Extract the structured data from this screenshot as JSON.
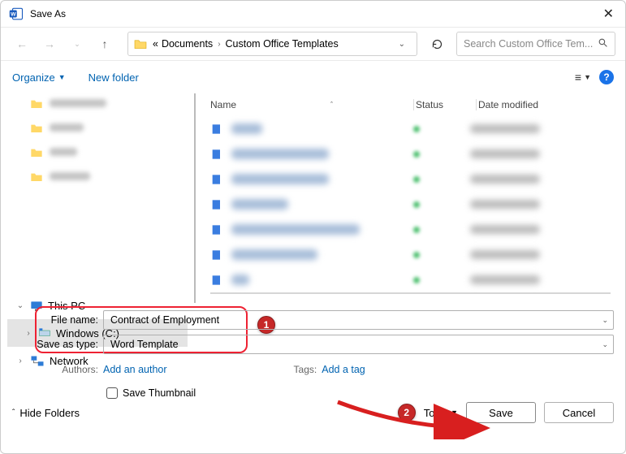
{
  "title": "Save As",
  "breadcrumb": {
    "prefix_indicator": "«",
    "segment1": "Documents",
    "segment2": "Custom Office Templates"
  },
  "search": {
    "placeholder": "Search Custom Office Tem..."
  },
  "toolbar": {
    "organize": "Organize",
    "new_folder": "New folder"
  },
  "sidebar": {
    "this_pc": "This PC",
    "windows_c": "Windows (C:)",
    "network": "Network"
  },
  "columns": {
    "name": "Name",
    "status": "Status",
    "date": "Date modified"
  },
  "form": {
    "file_name_label": "File name:",
    "file_name_value": "Contract of Employment",
    "save_type_label": "Save as type:",
    "save_type_value": "Word Template",
    "authors_label": "Authors:",
    "authors_value": "Add an author",
    "tags_label": "Tags:",
    "tags_value": "Add a tag",
    "save_thumbnail": "Save Thumbnail"
  },
  "bottom": {
    "hide_folders": "Hide Folders",
    "tools": "Tools",
    "save": "Save",
    "cancel": "Cancel"
  },
  "annotations": {
    "badge1": "1",
    "badge2": "2"
  }
}
